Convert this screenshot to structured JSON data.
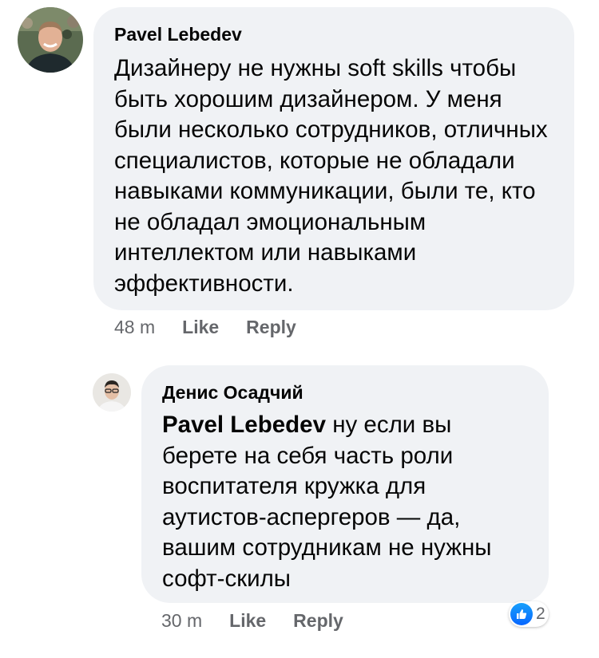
{
  "comments": [
    {
      "author": "Pavel Lebedev",
      "text": "Дизайнеру не нужны soft skills чтобы быть хорошим дизайнером. У меня были несколько сотрудников, отличных специалистов, которые не обладали навыками коммуникации, были те, кто не обладал эмоциональным интеллектом или навыками эффективности.",
      "time": "48 m",
      "like_label": "Like",
      "reply_label": "Reply"
    },
    {
      "author": "Денис Осадчий",
      "mention": "Pavel Lebedev",
      "text": "ну если вы берете на себя часть роли воспитателя кружка для аутистов-аспергеров — да, вашим сотрудникам не нужны софт-скилы",
      "time": "30 m",
      "like_label": "Like",
      "reply_label": "Reply",
      "reaction_icon": "like-icon",
      "reaction_count": "2"
    }
  ],
  "colors": {
    "bubble": "#f0f2f5",
    "meta_text": "#65676b",
    "like_blue": "#0866ff"
  }
}
